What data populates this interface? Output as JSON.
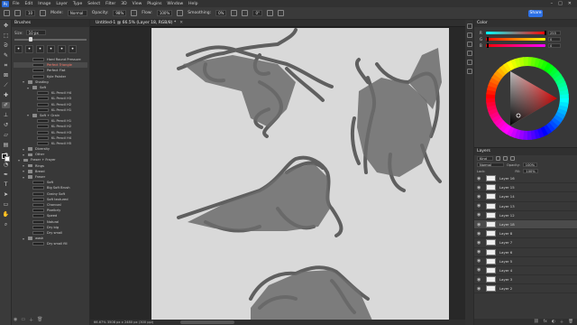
{
  "menubar": {
    "logo": "Ps",
    "items": [
      "File",
      "Edit",
      "Image",
      "Layer",
      "Type",
      "Select",
      "Filter",
      "3D",
      "View",
      "Plugins",
      "Window",
      "Help"
    ]
  },
  "options": {
    "size_value": "10",
    "mode_label": "Mode:",
    "mode_value": "Normal",
    "opacity_label": "Opacity:",
    "opacity_value": "98%",
    "flow_label": "Flow:",
    "flow_value": "100%",
    "smoothing_label": "Smoothing:",
    "smoothing_value": "0%",
    "angle_value": "0°",
    "share_label": "Share"
  },
  "brushes": {
    "title": "Brushes",
    "size_label": "Size:",
    "size_value": "10 px",
    "items": [
      {
        "label": "Hard Round Pressure",
        "level": 3,
        "kind": "brush",
        "selected": false
      },
      {
        "label": "Perfect Triangle",
        "level": 3,
        "kind": "brush",
        "selected": true,
        "red": true
      },
      {
        "label": "Perfect Flat",
        "level": 3,
        "kind": "brush",
        "selected": false
      },
      {
        "label": "Kyle Painter",
        "level": 3,
        "kind": "brush",
        "selected": false
      },
      {
        "label": "Shading",
        "level": 2,
        "kind": "folder",
        "selected": false
      },
      {
        "label": "Soft",
        "level": 3,
        "kind": "folder",
        "selected": false
      },
      {
        "label": "KL Pencil H4",
        "level": 4,
        "kind": "brush",
        "selected": false
      },
      {
        "label": "KL Pencil H3",
        "level": 4,
        "kind": "brush",
        "selected": false
      },
      {
        "label": "KL Pencil H2",
        "level": 4,
        "kind": "brush",
        "selected": false
      },
      {
        "label": "KL Pencil H1",
        "level": 4,
        "kind": "brush",
        "selected": false
      },
      {
        "label": "Soft + Grain",
        "level": 3,
        "kind": "folder",
        "selected": false
      },
      {
        "label": "KL Pencil H1",
        "level": 4,
        "kind": "brush",
        "selected": false
      },
      {
        "label": "KL Pencil H2",
        "level": 4,
        "kind": "brush",
        "selected": false
      },
      {
        "label": "KL Pencil H3",
        "level": 4,
        "kind": "brush",
        "selected": false
      },
      {
        "label": "KL Pencil H4",
        "level": 4,
        "kind": "brush",
        "selected": false
      },
      {
        "label": "KL Pencil H5",
        "level": 4,
        "kind": "brush",
        "selected": false
      },
      {
        "label": "Diversity",
        "level": 2,
        "kind": "folder",
        "selected": false
      },
      {
        "label": "Other",
        "level": 2,
        "kind": "folder",
        "selected": false
      },
      {
        "label": "Fraser + Frayer",
        "level": 1,
        "kind": "folder",
        "selected": false
      },
      {
        "label": "Rings",
        "level": 2,
        "kind": "folder",
        "selected": false
      },
      {
        "label": "Bread",
        "level": 2,
        "kind": "folder",
        "selected": false
      },
      {
        "label": "Fraser",
        "level": 2,
        "kind": "folder",
        "selected": false
      },
      {
        "label": "Soft",
        "level": 3,
        "kind": "brush",
        "selected": false
      },
      {
        "label": "Big Soft Brush",
        "level": 3,
        "kind": "brush",
        "selected": false
      },
      {
        "label": "Grainy Soft",
        "level": 3,
        "kind": "brush",
        "selected": false
      },
      {
        "label": "Soft textured",
        "level": 3,
        "kind": "brush",
        "selected": false
      },
      {
        "label": "Charcoal",
        "level": 3,
        "kind": "brush",
        "selected": false
      },
      {
        "label": "Pixelbrly",
        "level": 3,
        "kind": "brush",
        "selected": false
      },
      {
        "label": "Speed",
        "level": 3,
        "kind": "brush",
        "selected": false
      },
      {
        "label": "Natural",
        "level": 3,
        "kind": "brush",
        "selected": false
      },
      {
        "label": "Dry big",
        "level": 3,
        "kind": "brush",
        "selected": false
      },
      {
        "label": "Dry small",
        "level": 3,
        "kind": "brush",
        "selected": false
      },
      {
        "label": "wash",
        "level": 2,
        "kind": "folder",
        "selected": false
      },
      {
        "label": "Dry small fill",
        "level": 3,
        "kind": "brush",
        "selected": false
      }
    ]
  },
  "document": {
    "tab_title": "Untitled-1 @ 66.5% (Layer 18, RGB/8) *",
    "status": "66.67%    3508 px x 2480 px (300 ppi)"
  },
  "color_panel": {
    "title": "Color",
    "rows": [
      {
        "label": "R",
        "value": "255",
        "knob": 0.98,
        "gradient": [
          "#00ffff",
          "#ff0000"
        ]
      },
      {
        "label": "G",
        "value": "0",
        "knob": 0.02,
        "gradient": [
          "#ff0000",
          "#ffff00"
        ]
      },
      {
        "label": "B",
        "value": "0",
        "knob": 0.02,
        "gradient": [
          "#ff0000",
          "#ff00ff"
        ]
      }
    ],
    "accent": "#ff0000"
  },
  "layers_panel": {
    "title": "Layers",
    "kind_label": "Kind",
    "mode_value": "Normal",
    "opacity_label": "Opacity:",
    "opacity_value": "100%",
    "lock_label": "Lock:",
    "fill_label": "Fill:",
    "fill_value": "100%",
    "layers": [
      {
        "name": "Layer 16",
        "selected": false
      },
      {
        "name": "Layer 15",
        "selected": false
      },
      {
        "name": "Layer 14",
        "selected": false
      },
      {
        "name": "Layer 13",
        "selected": false
      },
      {
        "name": "Layer 12",
        "selected": false
      },
      {
        "name": "Layer 18",
        "selected": true
      },
      {
        "name": "Layer 8",
        "selected": false
      },
      {
        "name": "Layer 7",
        "selected": false
      },
      {
        "name": "Layer 6",
        "selected": false
      },
      {
        "name": "Layer 5",
        "selected": false
      },
      {
        "name": "Layer 4",
        "selected": false
      },
      {
        "name": "Layer 3",
        "selected": false
      },
      {
        "name": "Layer 2",
        "selected": false
      }
    ]
  },
  "tools": [
    "move-icon",
    "marquee-icon",
    "lasso-icon",
    "quick-select-icon",
    "crop-icon",
    "frame-icon",
    "eyedropper-icon",
    "healing-icon",
    "brush-icon",
    "stamp-icon",
    "history-brush-icon",
    "eraser-icon",
    "gradient-icon",
    "blur-icon",
    "dodge-icon",
    "pen-icon",
    "type-icon",
    "path-select-icon",
    "shape-icon",
    "hand-icon",
    "zoom-icon"
  ]
}
